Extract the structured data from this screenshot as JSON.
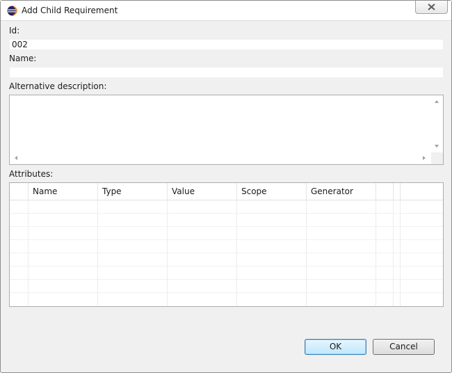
{
  "window": {
    "title": "Add Child Requirement",
    "icons": {
      "app": "eclipse-icon",
      "close": "close-icon"
    }
  },
  "form": {
    "id_label": "Id:",
    "id_value": "002",
    "name_label": "Name:",
    "name_value": "",
    "alt_desc_label": "Alternative description:",
    "alt_desc_value": ""
  },
  "attributes": {
    "label": "Attributes:",
    "columns": [
      "",
      "Name",
      "Type",
      "Value",
      "Scope",
      "Generator",
      "",
      ""
    ],
    "rows": []
  },
  "buttons": {
    "ok_label": "OK",
    "cancel_label": "Cancel"
  },
  "colors": {
    "default_button_border": "#3c7fb1",
    "dialog_background": "#f0f0f0"
  }
}
